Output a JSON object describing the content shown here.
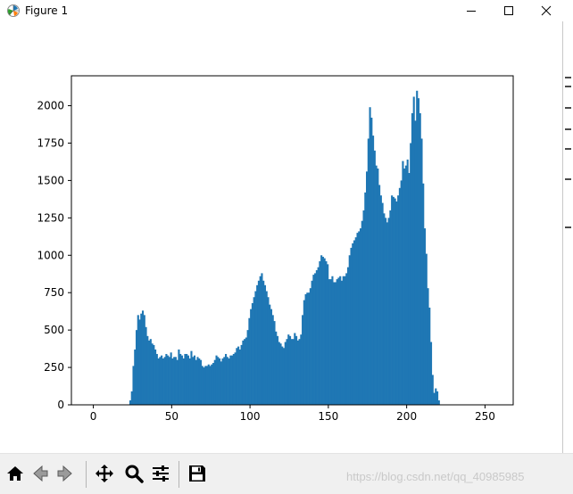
{
  "window": {
    "title": "Figure 1"
  },
  "toolbar": {
    "buttons": [
      {
        "icon": "home-icon",
        "name": "home-button"
      },
      {
        "icon": "back-arrow-icon",
        "name": "back-button"
      },
      {
        "icon": "forward-arrow-icon",
        "name": "forward-button"
      },
      {
        "icon": "pan-arrows-icon",
        "name": "pan-button"
      },
      {
        "icon": "zoom-magnifier-icon",
        "name": "zoom-button"
      },
      {
        "icon": "sliders-icon",
        "name": "configure-subplots-button"
      },
      {
        "icon": "floppy-disk-icon",
        "name": "save-button"
      }
    ]
  },
  "watermark": "https://blog.csdn.net/qq_40985985",
  "colors": {
    "bars": "#1f77b4",
    "axes": "#000000",
    "toolbar_bg": "#f0f0f0"
  },
  "chart_data": {
    "type": "bar",
    "title": "",
    "xlabel": "",
    "ylabel": "",
    "xlim": [
      -14,
      268
    ],
    "ylim": [
      0,
      2200
    ],
    "xticks": [
      0,
      50,
      100,
      150,
      200,
      250
    ],
    "yticks": [
      0,
      250,
      500,
      750,
      1000,
      1250,
      1500,
      1750,
      2000
    ],
    "grid": false,
    "legend": "none",
    "bin_width": 1,
    "x_start": 23,
    "values": [
      30,
      90,
      260,
      370,
      500,
      600,
      570,
      610,
      630,
      600,
      520,
      460,
      430,
      440,
      410,
      400,
      370,
      340,
      310,
      320,
      330,
      310,
      320,
      340,
      330,
      320,
      350,
      310,
      320,
      320,
      300,
      370,
      340,
      330,
      310,
      340,
      340,
      330,
      310,
      360,
      320,
      330,
      300,
      320,
      310,
      300,
      260,
      250,
      260,
      260,
      270,
      260,
      270,
      280,
      300,
      330,
      320,
      310,
      290,
      310,
      320,
      340,
      320,
      310,
      330,
      330,
      340,
      350,
      380,
      390,
      370,
      400,
      430,
      440,
      450,
      500,
      580,
      640,
      680,
      720,
      760,
      800,
      830,
      860,
      880,
      830,
      800,
      760,
      720,
      670,
      640,
      600,
      560,
      490,
      460,
      420,
      410,
      390,
      380,
      420,
      440,
      470,
      460,
      440,
      440,
      480,
      460,
      430,
      440,
      470,
      600,
      700,
      740,
      750,
      750,
      780,
      830,
      870,
      880,
      900,
      920,
      960,
      1000,
      990,
      980,
      960,
      940,
      840,
      840,
      860,
      820,
      820,
      840,
      850,
      860,
      830,
      860,
      860,
      880,
      920,
      1000,
      1050,
      1080,
      1100,
      1120,
      1150,
      1160,
      1180,
      1230,
      1300,
      1420,
      1560,
      1780,
      1990,
      1920,
      1800,
      1700,
      1600,
      1580,
      1470,
      1400,
      1350,
      1280,
      1250,
      1220,
      1250,
      1300,
      1400,
      1390,
      1380,
      1360,
      1400,
      1450,
      1500,
      1630,
      1580,
      1600,
      1640,
      1550,
      1750,
      1950,
      2060,
      1900,
      2100,
      2050,
      1950,
      1780,
      1480,
      1180,
      1010,
      780,
      650,
      420,
      200,
      80,
      110,
      90,
      30
    ],
    "count": 203
  }
}
